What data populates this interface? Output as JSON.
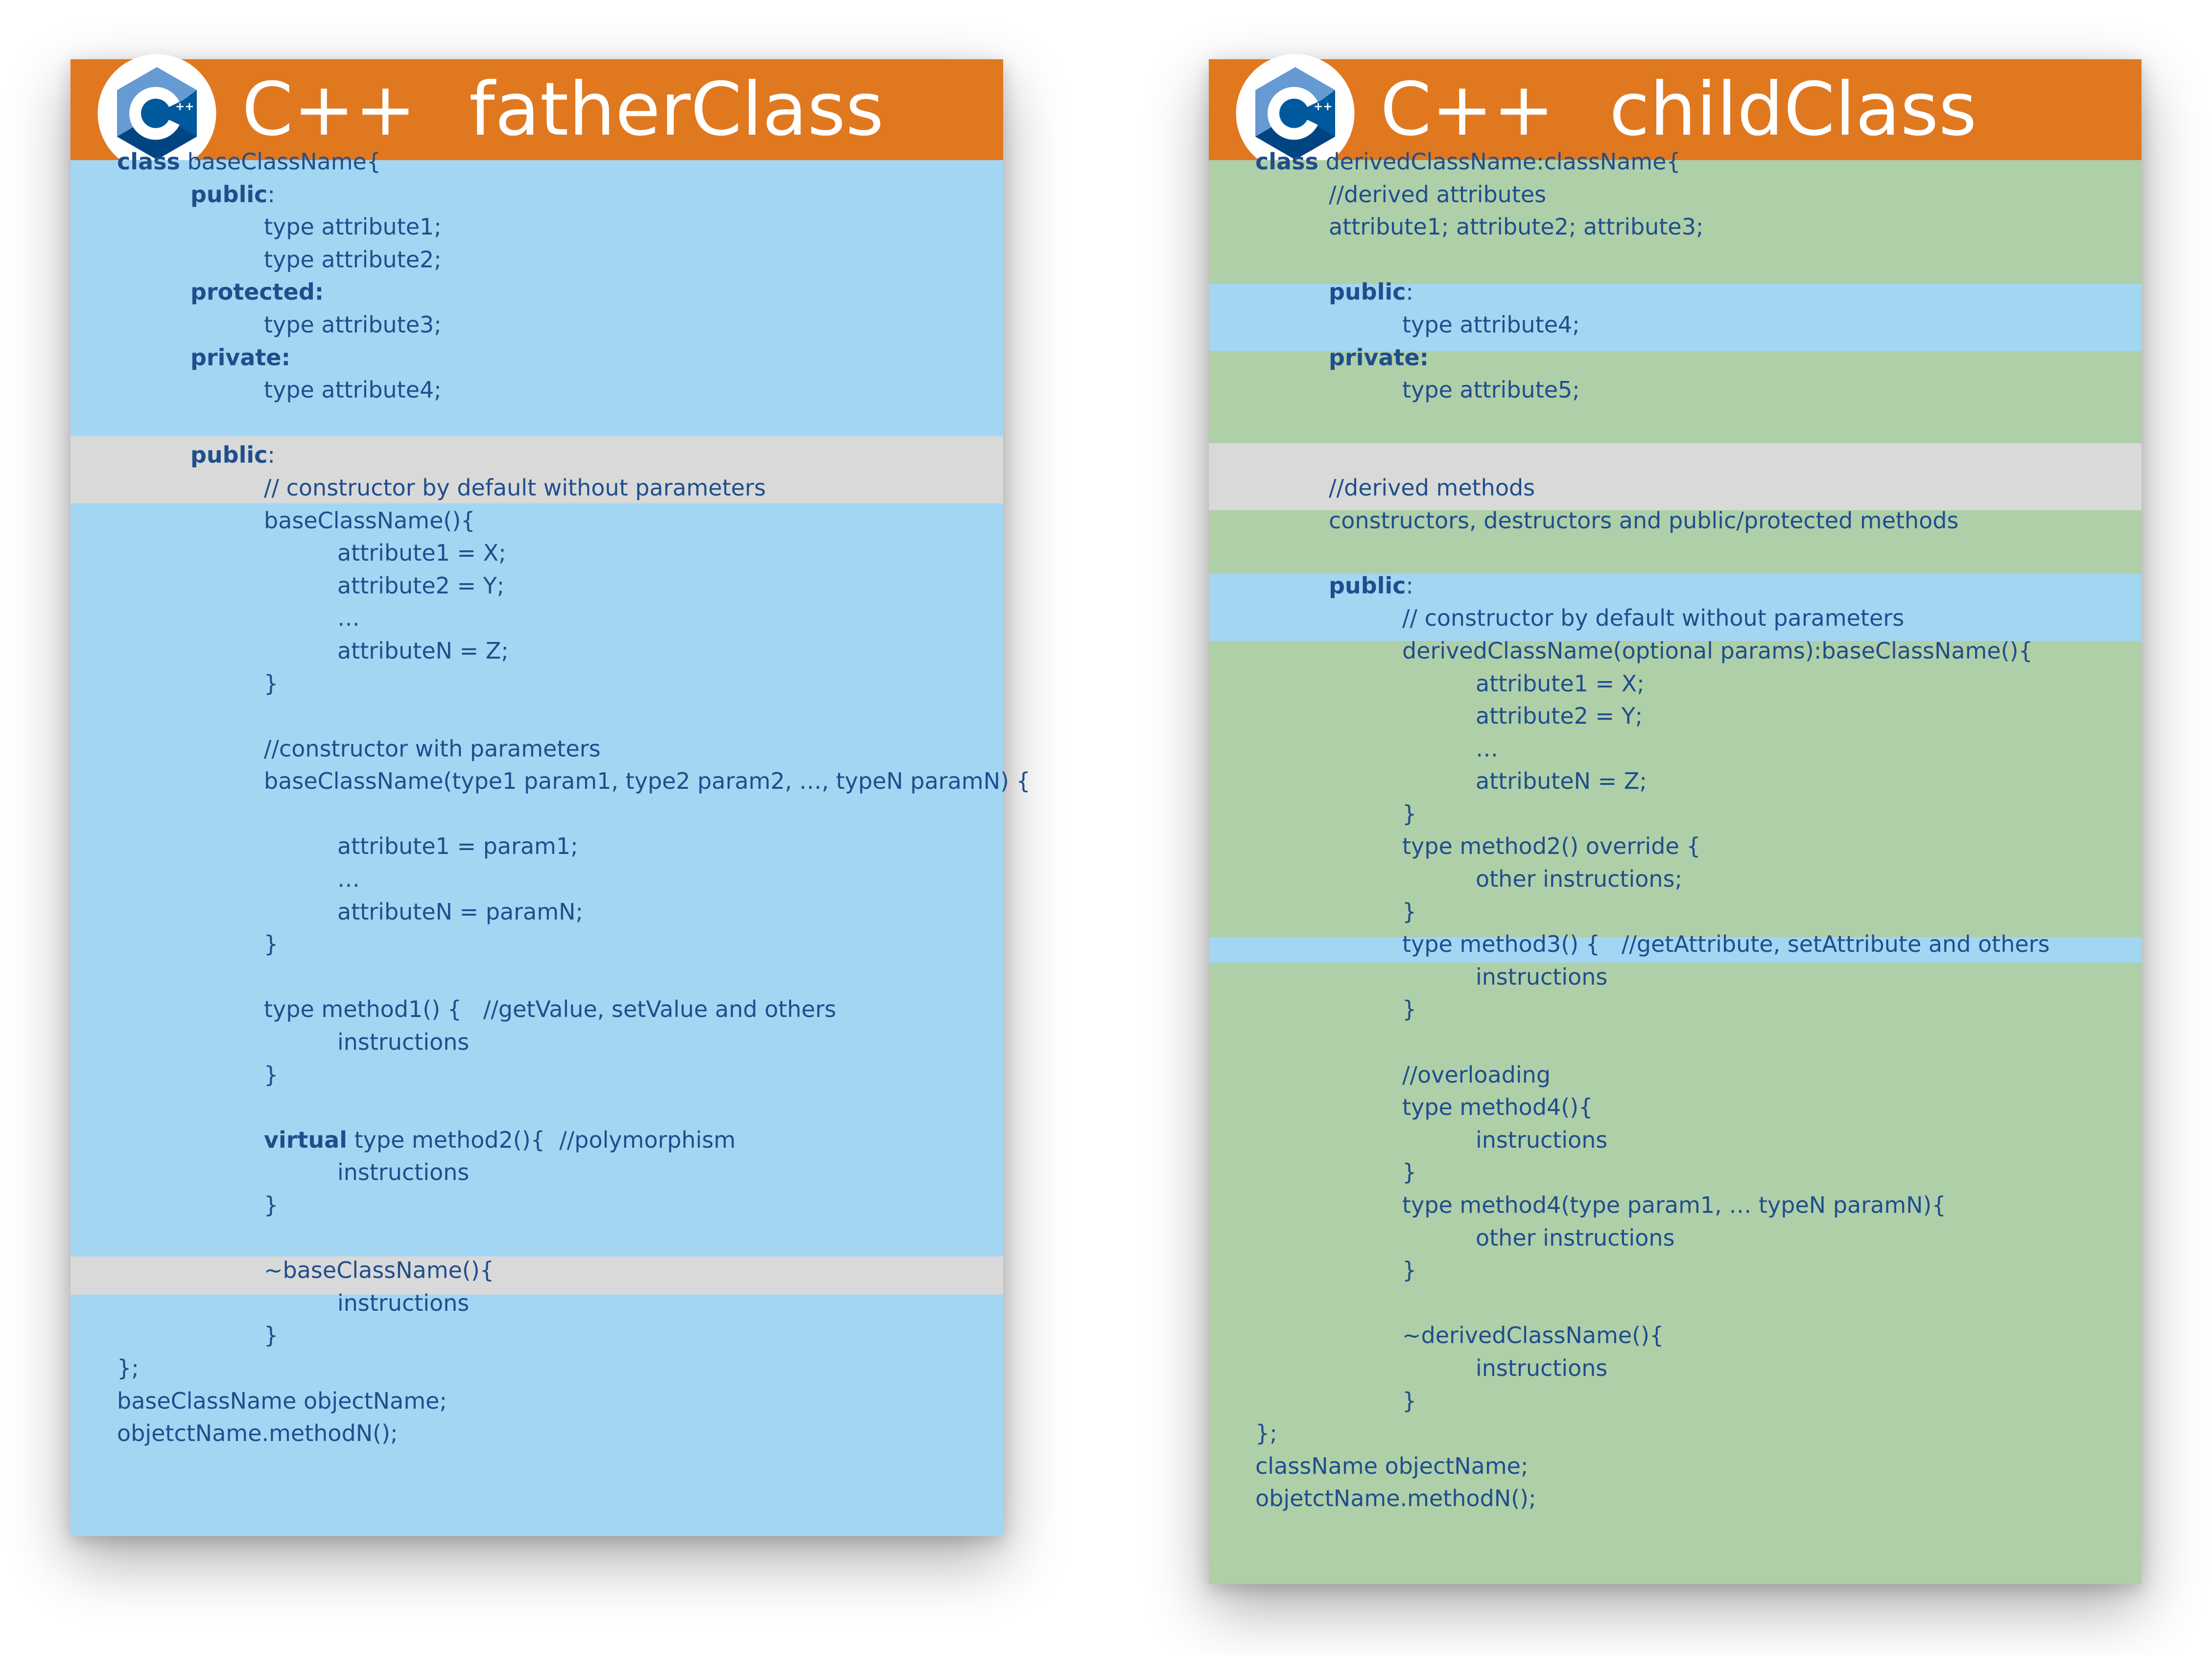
{
  "logo": {
    "icon": "cpp-logo-icon",
    "glyph": "C",
    "superscript": "++"
  },
  "colors": {
    "header": "#e07820",
    "father_body": "#a3d6f3",
    "child_body": "#afcfa9",
    "gray_band": "#d9d9d9",
    "code_text": "#1f4e8c",
    "logo_dark": "#004482",
    "logo_mid": "#00599c",
    "logo_light": "#659ad2"
  },
  "father": {
    "lang": "C++",
    "title": "fatherClass",
    "lines": [
      {
        "k": "class",
        "t": " baseClassName{"
      },
      {
        "k": "public",
        "t": ":"
      },
      {
        "t": "type attribute1;"
      },
      {
        "t": "type attribute2;"
      },
      {
        "k": "protected:",
        "t": ""
      },
      {
        "t": "type attribute3;"
      },
      {
        "k": "private:",
        "t": ""
      },
      {
        "t": "type attribute4;"
      },
      {
        "t": ""
      },
      {
        "k": "public",
        "t": ":"
      },
      {
        "t": "// constructor by default without parameters"
      },
      {
        "t": "baseClassName(){"
      },
      {
        "t": "attribute1 = X;"
      },
      {
        "t": "attribute2 = Y;"
      },
      {
        "t": "…"
      },
      {
        "t": "attributeN = Z;"
      },
      {
        "t": "}"
      },
      {
        "t": ""
      },
      {
        "t": "//constructor with parameters"
      },
      {
        "t": "baseClassName(type1 param1, type2 param2, …, typeN paramN) {"
      },
      {
        "t": ""
      },
      {
        "t": "attribute1 = param1;"
      },
      {
        "t": "…"
      },
      {
        "t": "attributeN = paramN;"
      },
      {
        "t": "}"
      },
      {
        "t": ""
      },
      {
        "t": "type method1() {   //getValue, setValue and others"
      },
      {
        "t": "instructions"
      },
      {
        "t": "}"
      },
      {
        "t": ""
      },
      {
        "k": "virtual",
        "t": " type method2(){  //polymorphism"
      },
      {
        "t": "instructions"
      },
      {
        "t": "}"
      },
      {
        "t": ""
      },
      {
        "t": "~baseClassName(){"
      },
      {
        "t": "instructions"
      },
      {
        "t": "}"
      },
      {
        "t": "};"
      },
      {
        "t": "baseClassName objectName;"
      },
      {
        "t": "objetctName.methodN();"
      }
    ]
  },
  "child": {
    "lang": "C++",
    "title": "childClass",
    "lines": [
      {
        "k": "class",
        "t": " derivedClassName:className{"
      },
      {
        "t": "//derived attributes"
      },
      {
        "t": "attribute1; attribute2; attribute3;"
      },
      {
        "t": ""
      },
      {
        "k": "public",
        "t": ":"
      },
      {
        "t": "type attribute4;"
      },
      {
        "k": "private:",
        "t": ""
      },
      {
        "t": "type attribute5;"
      },
      {
        "t": ""
      },
      {
        "t": ""
      },
      {
        "t": "//derived methods"
      },
      {
        "t": "constructors, destructors and public/protected methods"
      },
      {
        "t": ""
      },
      {
        "k": "public",
        "t": ":"
      },
      {
        "t": "// constructor by default without parameters"
      },
      {
        "t": "derivedClassName(optional params):baseClassName(){"
      },
      {
        "t": "attribute1 = X;"
      },
      {
        "t": "attribute2 = Y;"
      },
      {
        "t": "…"
      },
      {
        "t": "attributeN = Z;"
      },
      {
        "t": "}"
      },
      {
        "t": "type method2() override {"
      },
      {
        "t": "other instructions;"
      },
      {
        "t": "}"
      },
      {
        "t": "type method3() {   //getAttribute, setAttribute and others"
      },
      {
        "t": "instructions"
      },
      {
        "t": "}"
      },
      {
        "t": ""
      },
      {
        "t": "//overloading"
      },
      {
        "t": "type method4(){"
      },
      {
        "t": "instructions"
      },
      {
        "t": "}"
      },
      {
        "t": "type method4(type param1, … typeN paramN){"
      },
      {
        "t": "other instructions"
      },
      {
        "t": "}"
      },
      {
        "t": ""
      },
      {
        "t": "~derivedClassName(){"
      },
      {
        "t": "instructions"
      },
      {
        "t": "}"
      },
      {
        "t": "};"
      },
      {
        "t": "className objectName;"
      },
      {
        "t": "objetctName.methodN();"
      }
    ]
  }
}
